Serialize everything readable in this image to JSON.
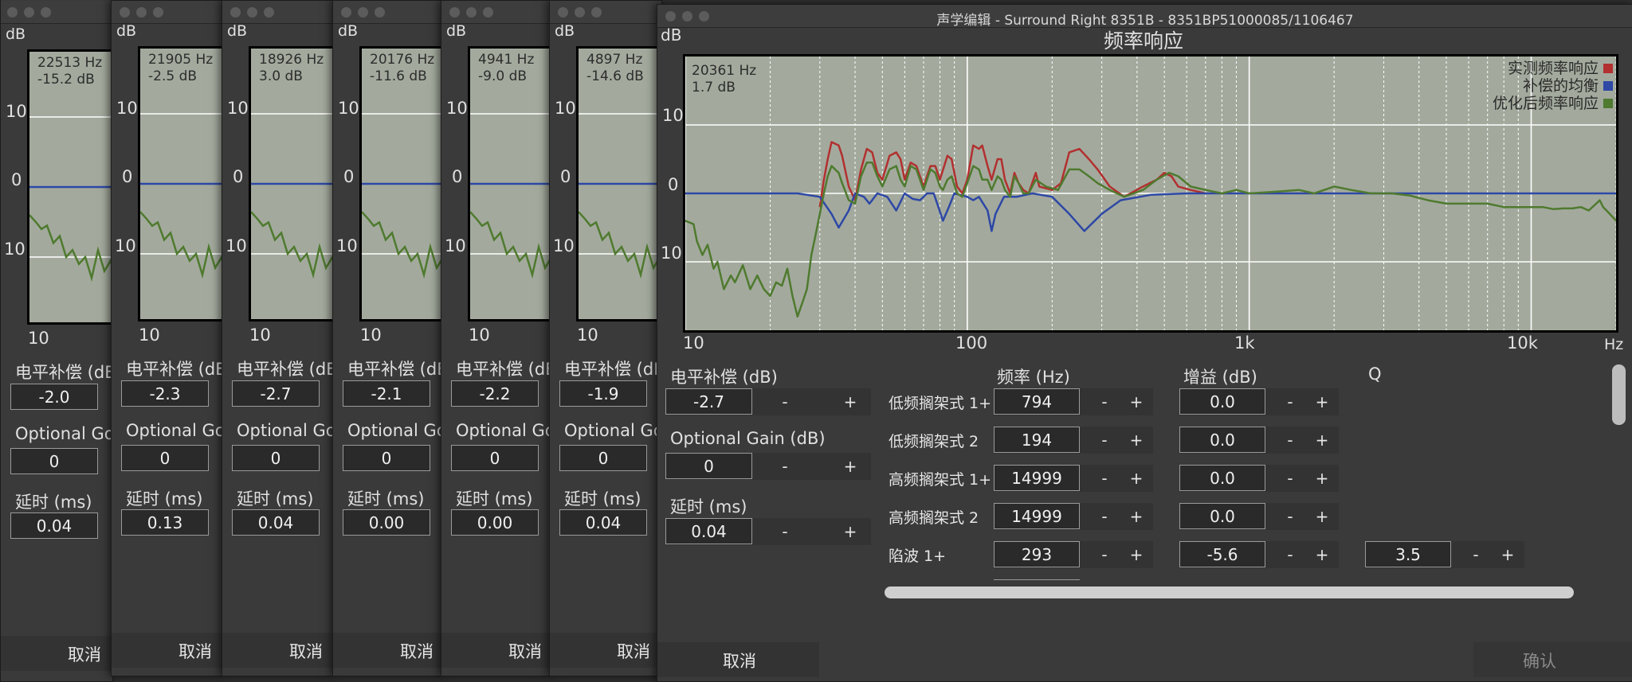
{
  "colors": {
    "measured": "#b23030",
    "compensation": "#2e48a6",
    "optimized": "#4f7a2f",
    "plot_bg": "#a3aa9d",
    "grid": "#ffffff"
  },
  "small_windows": [
    {
      "readout_hz": "22513 Hz",
      "readout_db": "-15.2 dB",
      "level": "-2.0",
      "optional_gain": "0",
      "delay": "0.04"
    },
    {
      "readout_hz": "21905 Hz",
      "readout_db": "-2.5 dB",
      "level": "-2.3",
      "optional_gain": "0",
      "delay": "0.13"
    },
    {
      "readout_hz": "18926 Hz",
      "readout_db": "3.0 dB",
      "level": "-2.7",
      "optional_gain": "0",
      "delay": "0.04"
    },
    {
      "readout_hz": "20176 Hz",
      "readout_db": "-11.6 dB",
      "level": "-2.1",
      "optional_gain": "0",
      "delay": "0.00"
    },
    {
      "readout_hz": "4941 Hz",
      "readout_db": "-9.0 dB",
      "level": "-2.2",
      "optional_gain": "0",
      "delay": "0.00"
    },
    {
      "readout_hz": "4897 Hz",
      "readout_db": "-14.6 dB",
      "level": "-1.9",
      "optional_gain": "0",
      "delay": "0.04"
    }
  ],
  "small_labels": {
    "db": "dB",
    "y10": "10",
    "y0": "0",
    "yminus10": "10",
    "x10": "10",
    "level_label": "电平补偿 (dB",
    "optional_label": "Optional Go",
    "delay_label": "延时 (ms)",
    "cancel": "取消"
  },
  "main": {
    "window_title": "声学编辑 - Surround Right 8351B - 8351BP51000085/1106467",
    "plot_title": "频率响应",
    "readout_hz": "20361 Hz",
    "readout_db": "1.7 dB",
    "level_label": "电平补偿 (dB)",
    "level_value": "-2.7",
    "optional_label": "Optional Gain (dB)",
    "optional_value": "0",
    "delay_label": "延时 (ms)",
    "delay_value": "0.04",
    "minus": "-",
    "plus": "+",
    "col_freq": "频率 (Hz)",
    "col_gain": "增益 (dB)",
    "col_q": "Q",
    "filters": [
      {
        "name": "低频搁架式 1+",
        "freq": "794",
        "gain": "0.0",
        "q": ""
      },
      {
        "name": "低频搁架式 2",
        "freq": "194",
        "gain": "0.0",
        "q": ""
      },
      {
        "name": "高频搁架式 1+",
        "freq": "14999",
        "gain": "0.0",
        "q": ""
      },
      {
        "name": "高频搁架式 2",
        "freq": "14999",
        "gain": "0.0",
        "q": ""
      },
      {
        "name": "陷波 1+",
        "freq": "293",
        "gain": "-5.6",
        "q": "3.5"
      }
    ],
    "cancel": "取消",
    "confirm": "确认"
  },
  "chart_data": {
    "type": "line",
    "title": "频率响应",
    "xlabel": "Hz",
    "ylabel": "dB",
    "xscale": "log",
    "xlim": [
      10,
      20000
    ],
    "ylim": [
      -20,
      20
    ],
    "x_ticks": [
      "10",
      "100",
      "1k",
      "10k"
    ],
    "y_ticks": [
      "10",
      "0",
      "10"
    ],
    "legend_position": "top-right",
    "grid": true,
    "series": [
      {
        "name": "实测频率响应",
        "color": "#b23030",
        "points": [
          [
            30,
            -2
          ],
          [
            31,
            2
          ],
          [
            32,
            5
          ],
          [
            33,
            7.5
          ],
          [
            35,
            7
          ],
          [
            36,
            5.5
          ],
          [
            38,
            1
          ],
          [
            40,
            -1
          ],
          [
            42,
            3.5
          ],
          [
            44,
            6.5
          ],
          [
            46,
            6
          ],
          [
            48,
            3
          ],
          [
            50,
            2
          ],
          [
            53,
            5.5
          ],
          [
            56,
            6
          ],
          [
            58,
            5
          ],
          [
            60,
            2
          ],
          [
            63,
            4.5
          ],
          [
            66,
            4
          ],
          [
            70,
            1
          ],
          [
            74,
            4
          ],
          [
            77,
            4
          ],
          [
            80,
            2
          ],
          [
            85,
            5.5
          ],
          [
            88,
            5
          ],
          [
            92,
            1
          ],
          [
            96,
            0
          ],
          [
            100,
            2
          ],
          [
            105,
            7
          ],
          [
            110,
            6.5
          ],
          [
            113,
            7
          ],
          [
            118,
            4
          ],
          [
            122,
            2
          ],
          [
            128,
            5
          ],
          [
            132,
            5
          ],
          [
            136,
            2
          ],
          [
            142,
            0
          ],
          [
            147,
            3
          ],
          [
            152,
            1.5
          ],
          [
            158,
            0.5
          ],
          [
            165,
            0
          ],
          [
            175,
            3
          ],
          [
            180,
            1
          ],
          [
            200,
            0.5
          ],
          [
            215,
            1.5
          ],
          [
            230,
            6
          ],
          [
            250,
            6.5
          ],
          [
            270,
            5
          ],
          [
            290,
            3.5
          ],
          [
            320,
            1
          ],
          [
            360,
            -0.5
          ],
          [
            420,
            1
          ],
          [
            470,
            2
          ],
          [
            500,
            3
          ],
          [
            530,
            2.5
          ],
          [
            560,
            1
          ],
          [
            620,
            0.5
          ],
          [
            700,
            0
          ]
        ]
      },
      {
        "name": "补偿的均衡",
        "color": "#2e48a6",
        "points": [
          [
            10,
            0
          ],
          [
            25,
            0
          ],
          [
            30,
            -0.5
          ],
          [
            33,
            -3
          ],
          [
            35,
            -5
          ],
          [
            38,
            -2.5
          ],
          [
            40,
            0
          ],
          [
            43,
            -0.5
          ],
          [
            45,
            -1.5
          ],
          [
            48,
            0
          ],
          [
            52,
            -0.5
          ],
          [
            56,
            -2.5
          ],
          [
            60,
            0
          ],
          [
            64,
            -0.8
          ],
          [
            68,
            -1
          ],
          [
            72,
            0
          ],
          [
            76,
            0
          ],
          [
            79,
            -2
          ],
          [
            82,
            -4
          ],
          [
            86,
            -2
          ],
          [
            90,
            0
          ],
          [
            100,
            -0.5
          ],
          [
            105,
            -1
          ],
          [
            110,
            -0.5
          ],
          [
            118,
            -2.5
          ],
          [
            122,
            -5.5
          ],
          [
            126,
            -3
          ],
          [
            135,
            -0.5
          ],
          [
            150,
            -0.5
          ],
          [
            170,
            0
          ],
          [
            200,
            -0.5
          ],
          [
            230,
            -3
          ],
          [
            260,
            -5.5
          ],
          [
            300,
            -3
          ],
          [
            350,
            -1
          ],
          [
            450,
            -0.2
          ],
          [
            600,
            0
          ],
          [
            20000,
            0
          ]
        ]
      },
      {
        "name": "优化后频率响应",
        "color": "#4f7a2f",
        "points": [
          [
            10,
            -4
          ],
          [
            10.7,
            -4.5
          ],
          [
            11,
            -7
          ],
          [
            11.5,
            -9
          ],
          [
            12,
            -7.5
          ],
          [
            12.6,
            -11
          ],
          [
            13,
            -10
          ],
          [
            13.7,
            -14
          ],
          [
            14.5,
            -12
          ],
          [
            15,
            -13
          ],
          [
            16,
            -10.5
          ],
          [
            17,
            -14
          ],
          [
            18,
            -12
          ],
          [
            19,
            -14
          ],
          [
            20,
            -15
          ],
          [
            21,
            -13
          ],
          [
            22,
            -13.5
          ],
          [
            23,
            -11
          ],
          [
            24,
            -15
          ],
          [
            25,
            -18
          ],
          [
            26,
            -16
          ],
          [
            27,
            -14
          ],
          [
            28,
            -9
          ],
          [
            29,
            -6
          ],
          [
            30,
            -3
          ],
          [
            31,
            0
          ],
          [
            32,
            2.5
          ],
          [
            33,
            4
          ],
          [
            34,
            3.5
          ],
          [
            35,
            3
          ],
          [
            36,
            1.5
          ],
          [
            38,
            -1
          ],
          [
            40,
            -1.5
          ],
          [
            42,
            2.5
          ],
          [
            44,
            4.5
          ],
          [
            46,
            4.5
          ],
          [
            48,
            2.5
          ],
          [
            50,
            1
          ],
          [
            53,
            3.5
          ],
          [
            56,
            4
          ],
          [
            58,
            2
          ],
          [
            60,
            1
          ],
          [
            63,
            4
          ],
          [
            66,
            3.5
          ],
          [
            70,
            0.5
          ],
          [
            74,
            3.5
          ],
          [
            77,
            3
          ],
          [
            80,
            1
          ],
          [
            82,
            0.5
          ],
          [
            85,
            2
          ],
          [
            88,
            2.5
          ],
          [
            92,
            0
          ],
          [
            96,
            -0.5
          ],
          [
            100,
            1.5
          ],
          [
            105,
            4
          ],
          [
            110,
            3.5
          ],
          [
            113,
            2
          ],
          [
            118,
            2
          ],
          [
            122,
            0.5
          ],
          [
            128,
            2.5
          ],
          [
            132,
            2
          ],
          [
            136,
            0.5
          ],
          [
            142,
            -0.5
          ],
          [
            147,
            2.5
          ],
          [
            152,
            1.5
          ],
          [
            158,
            0
          ],
          [
            165,
            0
          ],
          [
            175,
            2
          ],
          [
            190,
            1
          ],
          [
            210,
            0.5
          ],
          [
            230,
            3.5
          ],
          [
            250,
            3.5
          ],
          [
            270,
            2.5
          ],
          [
            290,
            1.5
          ],
          [
            320,
            0.5
          ],
          [
            360,
            -0.5
          ],
          [
            420,
            0.5
          ],
          [
            470,
            2
          ],
          [
            520,
            3
          ],
          [
            560,
            2.5
          ],
          [
            620,
            1
          ],
          [
            700,
            0.5
          ],
          [
            800,
            0
          ],
          [
            900,
            0.5
          ],
          [
            1000,
            0
          ],
          [
            1200,
            0.2
          ],
          [
            1500,
            0.5
          ],
          [
            1700,
            0
          ],
          [
            2000,
            1
          ],
          [
            2300,
            0.5
          ],
          [
            2700,
            0
          ],
          [
            3200,
            0
          ],
          [
            3700,
            -0.3
          ],
          [
            4300,
            -1
          ],
          [
            5000,
            -1.5
          ],
          [
            6000,
            -1.5
          ],
          [
            7000,
            -1.5
          ],
          [
            8000,
            -2
          ],
          [
            9000,
            -2
          ],
          [
            10000,
            -2
          ],
          [
            11000,
            -2
          ],
          [
            12000,
            -2.3
          ],
          [
            13000,
            -2.2
          ],
          [
            14000,
            -2.2
          ],
          [
            15000,
            -2
          ],
          [
            16000,
            -2.5
          ],
          [
            17000,
            -1.5
          ],
          [
            17500,
            -1
          ],
          [
            18000,
            -2
          ],
          [
            19000,
            -3
          ],
          [
            20000,
            -4
          ]
        ]
      }
    ]
  }
}
